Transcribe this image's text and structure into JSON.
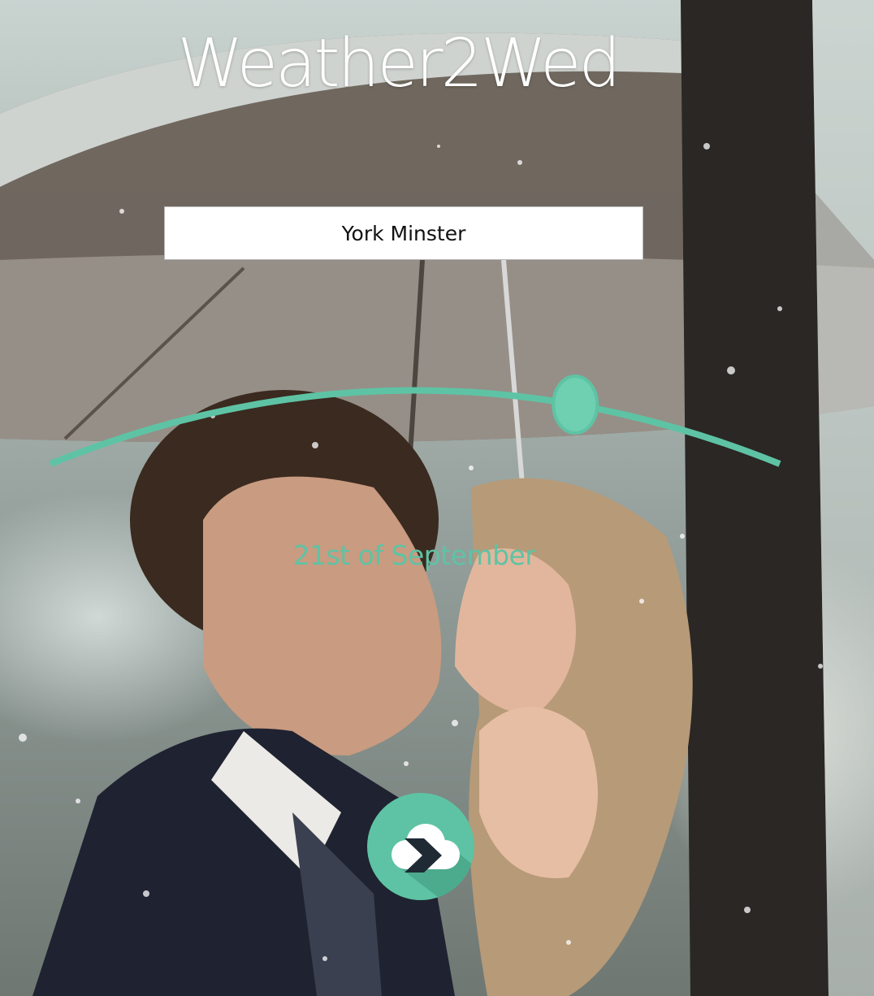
{
  "app": {
    "title": "Weather2Wed"
  },
  "venue": {
    "value": "York Minster"
  },
  "date_slider": {
    "selected_label": "21st of September",
    "position": 0.72
  },
  "submit": {
    "icon": "cloud-arrow-icon"
  },
  "colors": {
    "accent": "#5ec3a4",
    "title_text": "#ffffff"
  }
}
